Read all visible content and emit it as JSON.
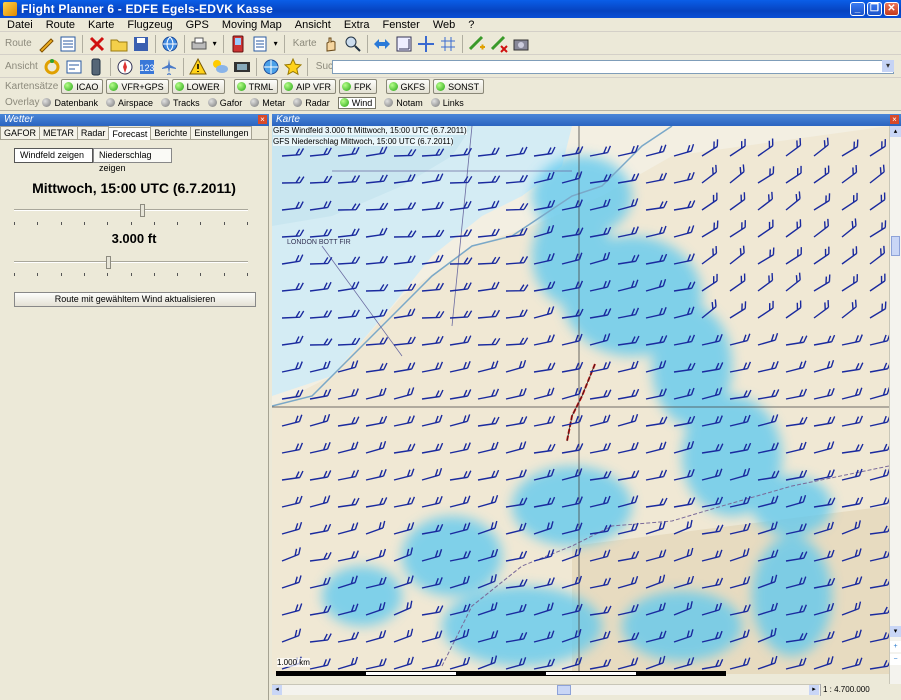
{
  "window": {
    "title": "Flight Planner 6 - EDFE Egels-EDVK Kasse"
  },
  "menu": [
    "Datei",
    "Route",
    "Karte",
    "Flugzeug",
    "GPS",
    "Moving Map",
    "Ansicht",
    "Extra",
    "Fenster",
    "Web",
    "?"
  ],
  "toolbar": {
    "route_label": "Route",
    "karte_label": "Karte",
    "ansicht_label": "Ansicht",
    "suche_label": "Suche",
    "search_value": ""
  },
  "kartensaetze": {
    "label": "Kartensätze",
    "items": [
      "ICAO",
      "VFR+GPS",
      "LOWER",
      "TRML",
      "AIP VFR",
      "FPK",
      "GKFS",
      "SONST"
    ]
  },
  "overlay": {
    "label": "Overlay",
    "items": [
      "Datenbank",
      "Airspace",
      "Tracks",
      "Gafor",
      "Metar",
      "Radar",
      "Wind",
      "Notam",
      "Links"
    ],
    "active": "Wind"
  },
  "weather_pane": {
    "title": "Wetter",
    "tabs": [
      "GAFOR",
      "METAR",
      "Radar",
      "Forecast",
      "Berichte",
      "Einstellungen"
    ],
    "active_tab": "Forecast",
    "buttons": {
      "wind": "Windfeld zeigen",
      "precip": "Niederschlag zeigen"
    },
    "datetime": "Mittwoch, 15:00 UTC (6.7.2011)",
    "altitude": "3.000 ft",
    "time_slider": 0.55,
    "alt_slider": 0.4,
    "update_button": "Route mit gewähltem Wind aktualisieren"
  },
  "map_pane": {
    "title": "Karte",
    "legend_wind": "GFS Windfeld 3.000 ft Mittwoch, 15:00 UTC (6.7.2011)",
    "legend_precip": "GFS Niederschlag Mittwoch, 15:00 UTC (6.7.2011)",
    "scale_text": "1.000 km",
    "zoom_text": "1 : 4.700.000",
    "map_labels": [
      "LONDON BOTT FIR"
    ]
  },
  "colors": {
    "title_bar": "#0a5ee8",
    "wind_barb": "#1a2a9e",
    "precip": "#5ac8f0",
    "route": "#e01010"
  }
}
